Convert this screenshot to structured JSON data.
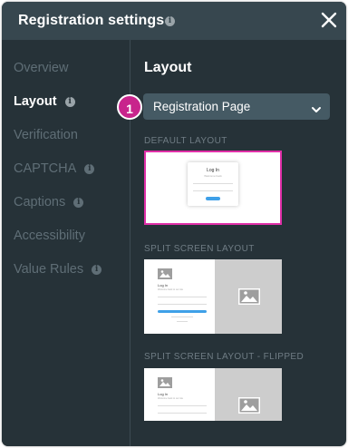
{
  "dialog": {
    "title": "Registration settings",
    "close_icon": "close-icon",
    "info_icon": "info-icon"
  },
  "sidebar": {
    "items": [
      {
        "label": "Overview",
        "active": false,
        "info": false
      },
      {
        "label": "Layout",
        "active": true,
        "info": true
      },
      {
        "label": "Verification",
        "active": false,
        "info": false
      },
      {
        "label": "CAPTCHA",
        "active": false,
        "info": true
      },
      {
        "label": "Captions",
        "active": false,
        "info": true
      },
      {
        "label": "Accessibility",
        "active": false,
        "info": false
      },
      {
        "label": "Value Rules",
        "active": false,
        "info": true
      }
    ]
  },
  "main": {
    "section_title": "Layout",
    "page_select": {
      "value": "Registration Page",
      "icon": "chevron-down-icon"
    },
    "step_badge": "1",
    "layouts": [
      {
        "label": "DEFAULT LAYOUT",
        "selected": true,
        "preview": {
          "title": "Log In",
          "subtitle": "Welcome back"
        }
      },
      {
        "label": "SPLIT SCREEN LAYOUT",
        "selected": false,
        "preview": {
          "title": "Log In",
          "subtitle": "Welcome back to our site"
        }
      },
      {
        "label": "SPLIT SCREEN LAYOUT - FLIPPED",
        "selected": false,
        "preview": {
          "title": "Log In",
          "subtitle": "Welcome back to our site"
        }
      }
    ]
  },
  "colors": {
    "dialog_bg": "#263238",
    "header_bg": "#37474f",
    "select_bg": "#455a64",
    "accent_magenta": "#c8248c",
    "selected_border": "#e02fa8",
    "inactive_text": "#5f6e76",
    "mini_button_blue": "#3fa0e8"
  }
}
